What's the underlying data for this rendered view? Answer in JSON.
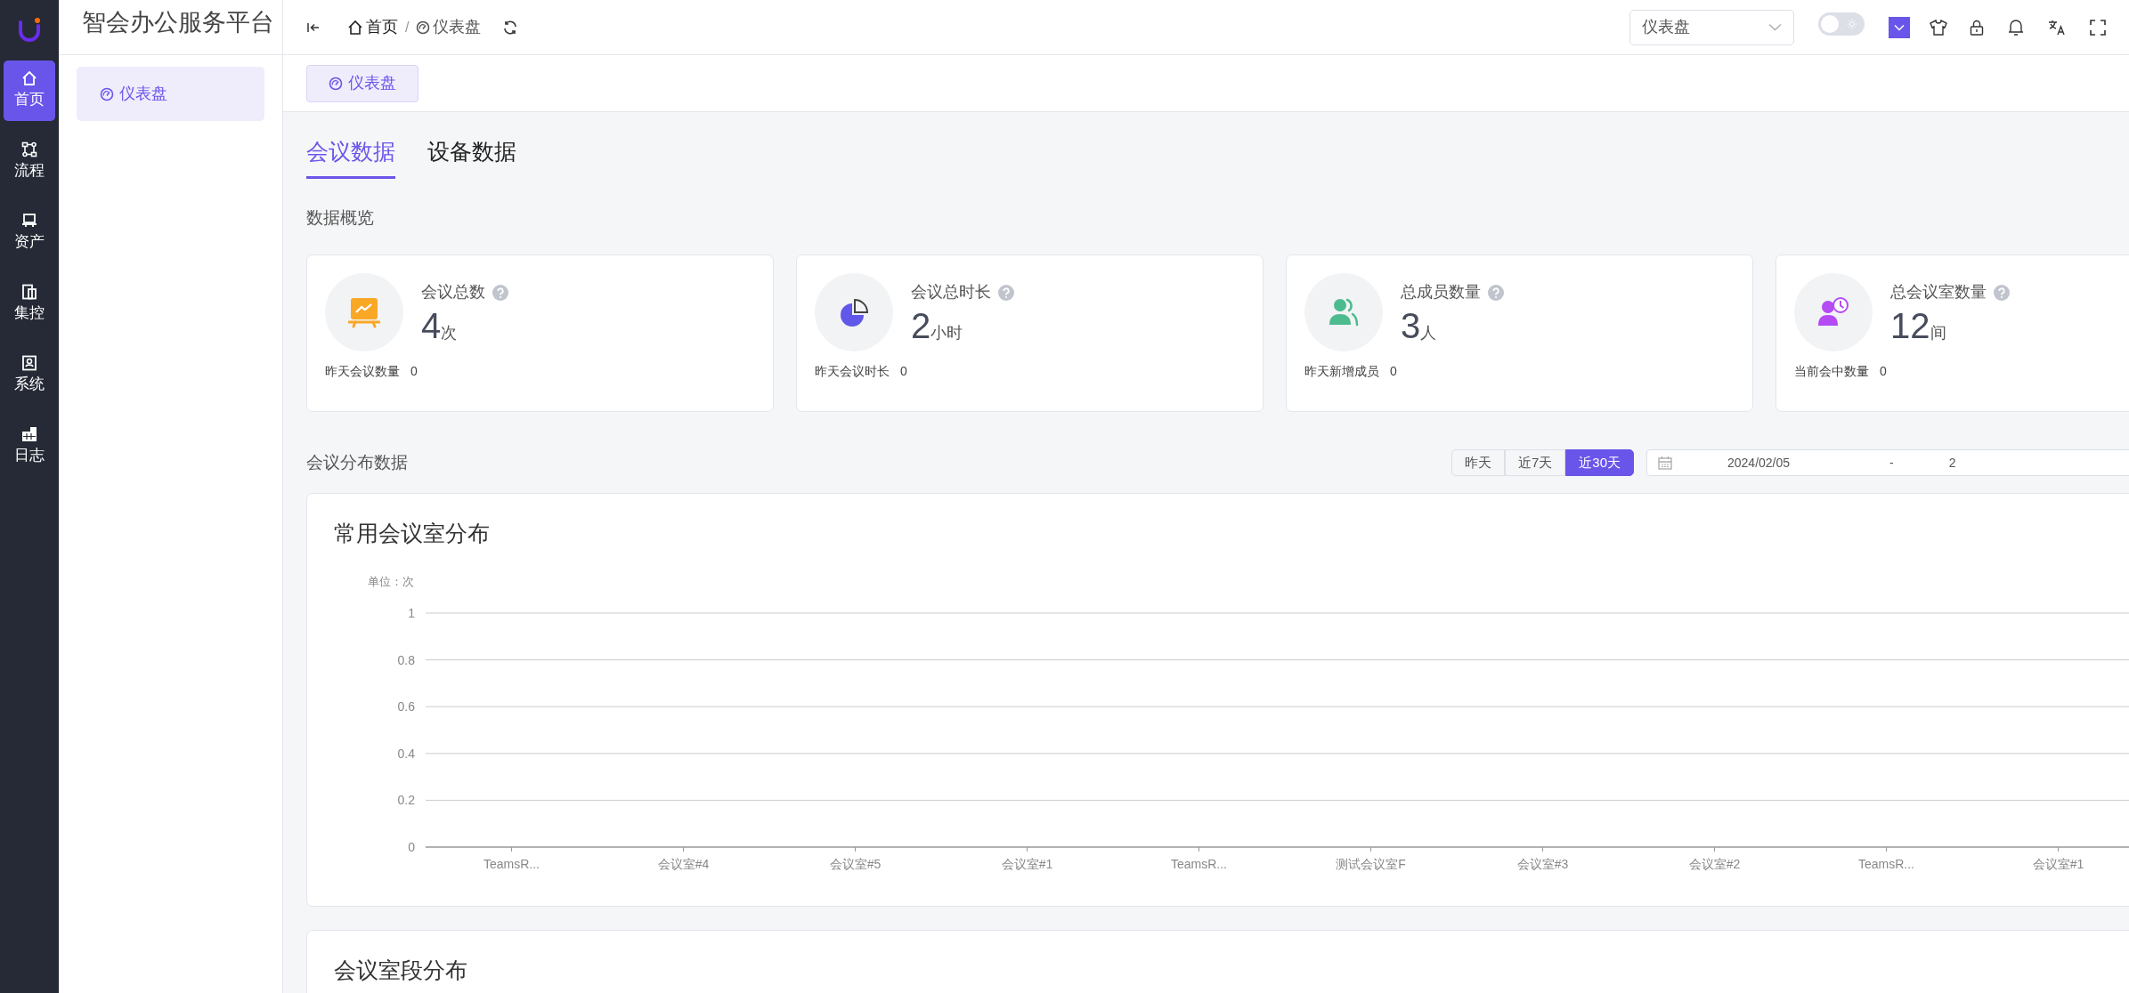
{
  "app": {
    "title": "智会办公服务平台"
  },
  "rail": [
    {
      "label": "首页",
      "selected": true
    },
    {
      "label": "流程",
      "selected": false
    },
    {
      "label": "资产",
      "selected": false
    },
    {
      "label": "集控",
      "selected": false
    },
    {
      "label": "系统",
      "selected": false
    },
    {
      "label": "日志",
      "selected": false
    }
  ],
  "sidebar": {
    "items": [
      {
        "label": "仪表盘",
        "selected": true
      }
    ]
  },
  "header": {
    "breadcrumb": [
      {
        "label": "首页"
      },
      {
        "label": "仪表盘"
      }
    ],
    "breadcrumb_separator": "/",
    "page_select": {
      "value": "仪表盘"
    },
    "theme_toggle": {
      "on": false
    }
  },
  "page_tabs": [
    {
      "label": "仪表盘",
      "selected": true
    }
  ],
  "tabs": [
    {
      "label": "会议数据",
      "selected": true
    },
    {
      "label": "设备数据",
      "selected": false
    }
  ],
  "overview": {
    "title": "数据概览",
    "cards": [
      {
        "title": "会议总数",
        "value": "4",
        "unit": "次",
        "footer_label": "昨天会议数量",
        "footer_value": "0"
      },
      {
        "title": "会议总时长",
        "value": "2",
        "unit": "小时",
        "footer_label": "昨天会议时长",
        "footer_value": "0"
      },
      {
        "title": "总成员数量",
        "value": "3",
        "unit": "人",
        "footer_label": "昨天新增成员",
        "footer_value": "0"
      },
      {
        "title": "总会议室数量",
        "value": "12",
        "unit": "间",
        "footer_label": "当前会中数量",
        "footer_value": "0"
      }
    ]
  },
  "distribution": {
    "title": "会议分布数据",
    "ranges": [
      {
        "label": "昨天",
        "selected": false
      },
      {
        "label": "近7天",
        "selected": false
      },
      {
        "label": "近30天",
        "selected": true
      }
    ],
    "date_range": {
      "start": "2024/02/05",
      "separator": "-",
      "end": "2"
    },
    "charts": [
      {
        "title": "常用会议室分布",
        "chart_data": {
          "type": "bar",
          "ylabel": "单位：次",
          "categories": [
            "TeamsR...",
            "会议室#4",
            "会议室#5",
            "会议室#1",
            "TeamsR...",
            "测试会议室F",
            "会议室#3",
            "会议室#2",
            "TeamsR...",
            "会议室#1"
          ],
          "values": [
            0,
            0,
            0,
            0,
            0,
            0,
            0,
            0,
            0,
            0
          ],
          "ylim": [
            0,
            1
          ],
          "yticks": [
            0,
            0.2,
            0.4,
            0.6,
            0.8,
            1
          ],
          "grid": true
        }
      },
      {
        "title": "会议室段分布"
      }
    ]
  }
}
